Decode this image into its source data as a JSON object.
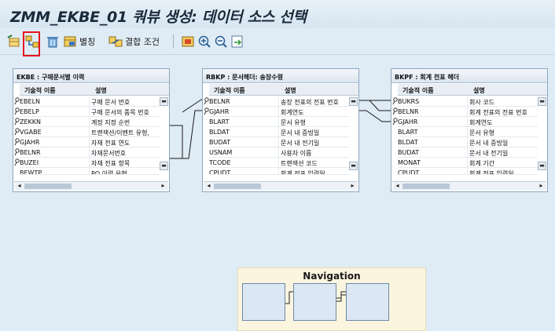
{
  "title": "ZMM_EKBE_01 쿼뷰 생성: 데이터 소스 선택",
  "toolbar": {
    "join_label": "결합 조건",
    "table_label": "별칭"
  },
  "column_headers": {
    "tech_name": "기술적 이름",
    "description": "설명"
  },
  "tables": [
    {
      "header": "EKBE : 구매문서별 이력",
      "rows": [
        {
          "name": "EBELN",
          "desc": "구매 문서 번호",
          "key": true
        },
        {
          "name": "EBELP",
          "desc": "구매 문서의 품목 번호",
          "key": true
        },
        {
          "name": "ZEKKN",
          "desc": "계정 지정 순번",
          "key": true
        },
        {
          "name": "VGABE",
          "desc": "트랜잭션/이벤트 유형,",
          "key": true
        },
        {
          "name": "GJAHR",
          "desc": "자재 전표 연도",
          "key": true
        },
        {
          "name": "BELNR",
          "desc": "자재문서번호",
          "key": true
        },
        {
          "name": "BUZEI",
          "desc": "자재 전표 항목",
          "key": true
        },
        {
          "name": "BEWTP",
          "desc": "PO 이력 유형",
          "key": false
        }
      ]
    },
    {
      "header": "RBKP : 문서헤더: 송장수령",
      "rows": [
        {
          "name": "BELNR",
          "desc": "송장 전표의 전표 번호",
          "key": true
        },
        {
          "name": "GJAHR",
          "desc": "회계연도",
          "key": true
        },
        {
          "name": "BLART",
          "desc": "문서 유형",
          "key": false
        },
        {
          "name": "BLDAT",
          "desc": "문서 내 증빙일",
          "key": false
        },
        {
          "name": "BUDAT",
          "desc": "문서 내 전기일",
          "key": false
        },
        {
          "name": "USNAM",
          "desc": "사용자 이름",
          "key": false
        },
        {
          "name": "TCODE",
          "desc": "트랜잭션 코드",
          "key": false
        },
        {
          "name": "CPUDT",
          "desc": "회계 전표 입력일",
          "key": false
        }
      ]
    },
    {
      "header": "BKPF : 회계 전표 헤더",
      "rows": [
        {
          "name": "BUKRS",
          "desc": "회사 코드",
          "key": true
        },
        {
          "name": "BELNR",
          "desc": "회계 전표의 전표 번호",
          "key": true
        },
        {
          "name": "GJAHR",
          "desc": "회계연도",
          "key": true
        },
        {
          "name": "BLART",
          "desc": "문서 유형",
          "key": false
        },
        {
          "name": "BLDAT",
          "desc": "문서 내 증빙일",
          "key": false
        },
        {
          "name": "BUDAT",
          "desc": "문서 내 전기일",
          "key": false
        },
        {
          "name": "MONAT",
          "desc": "회계 기간",
          "key": false
        },
        {
          "name": "CPUDT",
          "desc": "회계 전표 입력일",
          "key": false
        }
      ]
    }
  ],
  "navigation": {
    "title": "Navigation"
  },
  "colors": {
    "highlight": "#e5131f",
    "background": "#dfebf5",
    "link_line": "#1a1a1a"
  },
  "icons": [
    "insert-table-icon",
    "join-tables-icon",
    "delete-icon",
    "alias-icon",
    "join-condition-icon",
    "overview-icon",
    "zoom-in-icon",
    "zoom-out-icon",
    "export-icon"
  ]
}
